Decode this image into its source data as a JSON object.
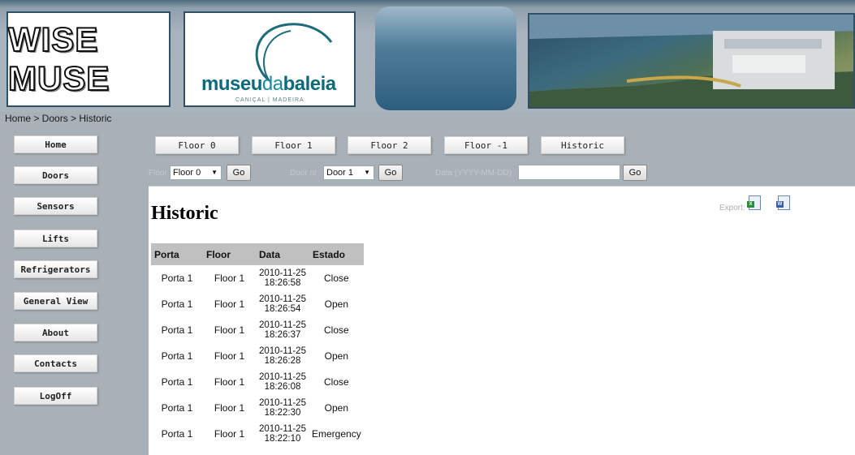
{
  "header": {
    "wise_logo_text": "WISE MUSE",
    "museum_logo": {
      "part1": "museu",
      "part2": "da",
      "part3": "baleia",
      "subtitle": "CANIÇAL | MADEIRA"
    }
  },
  "breadcrumb": "Home > Doors > Historic",
  "sidebar": {
    "items": [
      {
        "label": "Home"
      },
      {
        "label": "Doors"
      },
      {
        "label": "Sensors"
      },
      {
        "label": "Lifts"
      },
      {
        "label": "Refrigerators"
      },
      {
        "label": "General View"
      },
      {
        "label": "About"
      },
      {
        "label": "Contacts"
      },
      {
        "label": "LogOff"
      }
    ]
  },
  "topnav": {
    "items": [
      {
        "label": "Floor 0"
      },
      {
        "label": "Floor 1"
      },
      {
        "label": "Floor 2"
      },
      {
        "label": "Floor -1"
      },
      {
        "label": "Historic"
      }
    ]
  },
  "filters": {
    "floor_label": "Floor",
    "floor_value": "Floor 0",
    "door_label": "Door nr",
    "door_value": "Door 1",
    "date_label": "Data (YYYY-MM-DD)",
    "date_value": "",
    "go_label": "Go"
  },
  "page_title": "Historic",
  "export": {
    "label": "Export:",
    "excel_tag": "X",
    "word_tag": "W"
  },
  "table": {
    "headers": [
      "Porta",
      "Floor",
      "Data",
      "Estado"
    ],
    "rows": [
      {
        "porta": "Porta 1",
        "floor": "Floor 1",
        "date": "2010-11-25",
        "time": "18:26:58",
        "estado": "Close"
      },
      {
        "porta": "Porta 1",
        "floor": "Floor 1",
        "date": "2010-11-25",
        "time": "18:26:54",
        "estado": "Open"
      },
      {
        "porta": "Porta 1",
        "floor": "Floor 1",
        "date": "2010-11-25",
        "time": "18:26:37",
        "estado": "Close"
      },
      {
        "porta": "Porta 1",
        "floor": "Floor 1",
        "date": "2010-11-25",
        "time": "18:26:28",
        "estado": "Open"
      },
      {
        "porta": "Porta 1",
        "floor": "Floor 1",
        "date": "2010-11-25",
        "time": "18:26:08",
        "estado": "Close"
      },
      {
        "porta": "Porta 1",
        "floor": "Floor 1",
        "date": "2010-11-25",
        "time": "18:22:30",
        "estado": "Open"
      },
      {
        "porta": "Porta 1",
        "floor": "Floor 1",
        "date": "2010-11-25",
        "time": "18:22:10",
        "estado": "Emergency"
      }
    ]
  }
}
